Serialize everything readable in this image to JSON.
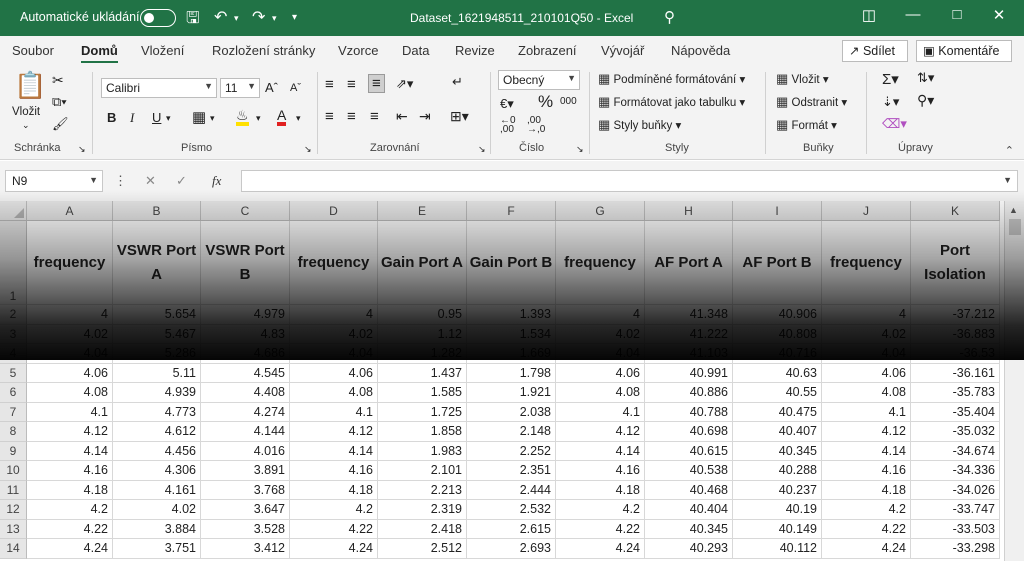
{
  "titlebar": {
    "autosave_label": "Automatické ukládání",
    "document_title": "Dataset_1621948511_210101Q50  -  Excel",
    "icons": [
      "save-icon",
      "undo-icon",
      "redo-icon",
      "customize-icon",
      "search-icon",
      "ribbon-display-icon",
      "minimize-icon",
      "maximize-icon",
      "close-icon"
    ]
  },
  "tabs": [
    "Soubor",
    "Domů",
    "Vložení",
    "Rozložení stránky",
    "Vzorce",
    "Data",
    "Revize",
    "Zobrazení",
    "Vývojář",
    "Nápověda"
  ],
  "active_tab": "Domů",
  "share_label": "Sdílet",
  "comments_label": "Komentáře",
  "ribbon": {
    "clipboard": {
      "paste": "Vložit",
      "label": "Schránka"
    },
    "font": {
      "name": "Calibri",
      "size": "11",
      "bold": "B",
      "italic": "I",
      "underline": "U",
      "label": "Písmo"
    },
    "alignment": {
      "label": "Zarovnání"
    },
    "number": {
      "format": "Obecný",
      "percent": "%",
      "thousands": "000",
      "label": "Číslo"
    },
    "styles": {
      "cond_format": "Podmíněné formátování",
      "format_table": "Formátovat jako tabulku",
      "cell_styles": "Styly buňky",
      "label": "Styly"
    },
    "cells": {
      "insert": "Vložit",
      "delete": "Odstranit",
      "format": "Formát",
      "label": "Buňky"
    },
    "editing": {
      "label": "Úpravy"
    }
  },
  "formula_bar": {
    "name_box": "N9",
    "fx": "fx",
    "value": ""
  },
  "columns": [
    "A",
    "B",
    "C",
    "D",
    "E",
    "F",
    "G",
    "H",
    "I",
    "J",
    "K"
  ],
  "header_row": {
    "row_number": "1",
    "cells": [
      "frequency",
      "VSWR Port A",
      "VSWR Port B",
      "frequency",
      "Gain Port A",
      "Gain Port B",
      "frequency",
      "AF Port A",
      "AF Port B",
      "frequency",
      "Port Isolation"
    ]
  },
  "rows": [
    {
      "n": "2",
      "c": [
        "4",
        "5.654",
        "4.979",
        "4",
        "0.95",
        "1.393",
        "4",
        "41.348",
        "40.906",
        "4",
        "-37.212"
      ]
    },
    {
      "n": "3",
      "c": [
        "4.02",
        "5.467",
        "4.83",
        "4.02",
        "1.12",
        "1.534",
        "4.02",
        "41.222",
        "40.808",
        "4.02",
        "-36.883"
      ]
    },
    {
      "n": "4",
      "c": [
        "4.04",
        "5.286",
        "4.686",
        "4.04",
        "1.282",
        "1.669",
        "4.04",
        "41.103",
        "40.716",
        "4.04",
        "-36.53"
      ]
    },
    {
      "n": "5",
      "c": [
        "4.06",
        "5.11",
        "4.545",
        "4.06",
        "1.437",
        "1.798",
        "4.06",
        "40.991",
        "40.63",
        "4.06",
        "-36.161"
      ]
    },
    {
      "n": "6",
      "c": [
        "4.08",
        "4.939",
        "4.408",
        "4.08",
        "1.585",
        "1.921",
        "4.08",
        "40.886",
        "40.55",
        "4.08",
        "-35.783"
      ]
    },
    {
      "n": "7",
      "c": [
        "4.1",
        "4.773",
        "4.274",
        "4.1",
        "1.725",
        "2.038",
        "4.1",
        "40.788",
        "40.475",
        "4.1",
        "-35.404"
      ]
    },
    {
      "n": "8",
      "c": [
        "4.12",
        "4.612",
        "4.144",
        "4.12",
        "1.858",
        "2.148",
        "4.12",
        "40.698",
        "40.407",
        "4.12",
        "-35.032"
      ]
    },
    {
      "n": "9",
      "c": [
        "4.14",
        "4.456",
        "4.016",
        "4.14",
        "1.983",
        "2.252",
        "4.14",
        "40.615",
        "40.345",
        "4.14",
        "-34.674"
      ]
    },
    {
      "n": "10",
      "c": [
        "4.16",
        "4.306",
        "3.891",
        "4.16",
        "2.101",
        "2.351",
        "4.16",
        "40.538",
        "40.288",
        "4.16",
        "-34.336"
      ]
    },
    {
      "n": "11",
      "c": [
        "4.18",
        "4.161",
        "3.768",
        "4.18",
        "2.213",
        "2.444",
        "4.18",
        "40.468",
        "40.237",
        "4.18",
        "-34.026"
      ]
    },
    {
      "n": "12",
      "c": [
        "4.2",
        "4.02",
        "3.647",
        "4.2",
        "2.319",
        "2.532",
        "4.2",
        "40.404",
        "40.19",
        "4.2",
        "-33.747"
      ]
    },
    {
      "n": "13",
      "c": [
        "4.22",
        "3.884",
        "3.528",
        "4.22",
        "2.418",
        "2.615",
        "4.22",
        "40.345",
        "40.149",
        "4.22",
        "-33.503"
      ]
    },
    {
      "n": "14",
      "c": [
        "4.24",
        "3.751",
        "3.412",
        "4.24",
        "2.512",
        "2.693",
        "4.24",
        "40.293",
        "40.112",
        "4.24",
        "-33.298"
      ]
    }
  ]
}
